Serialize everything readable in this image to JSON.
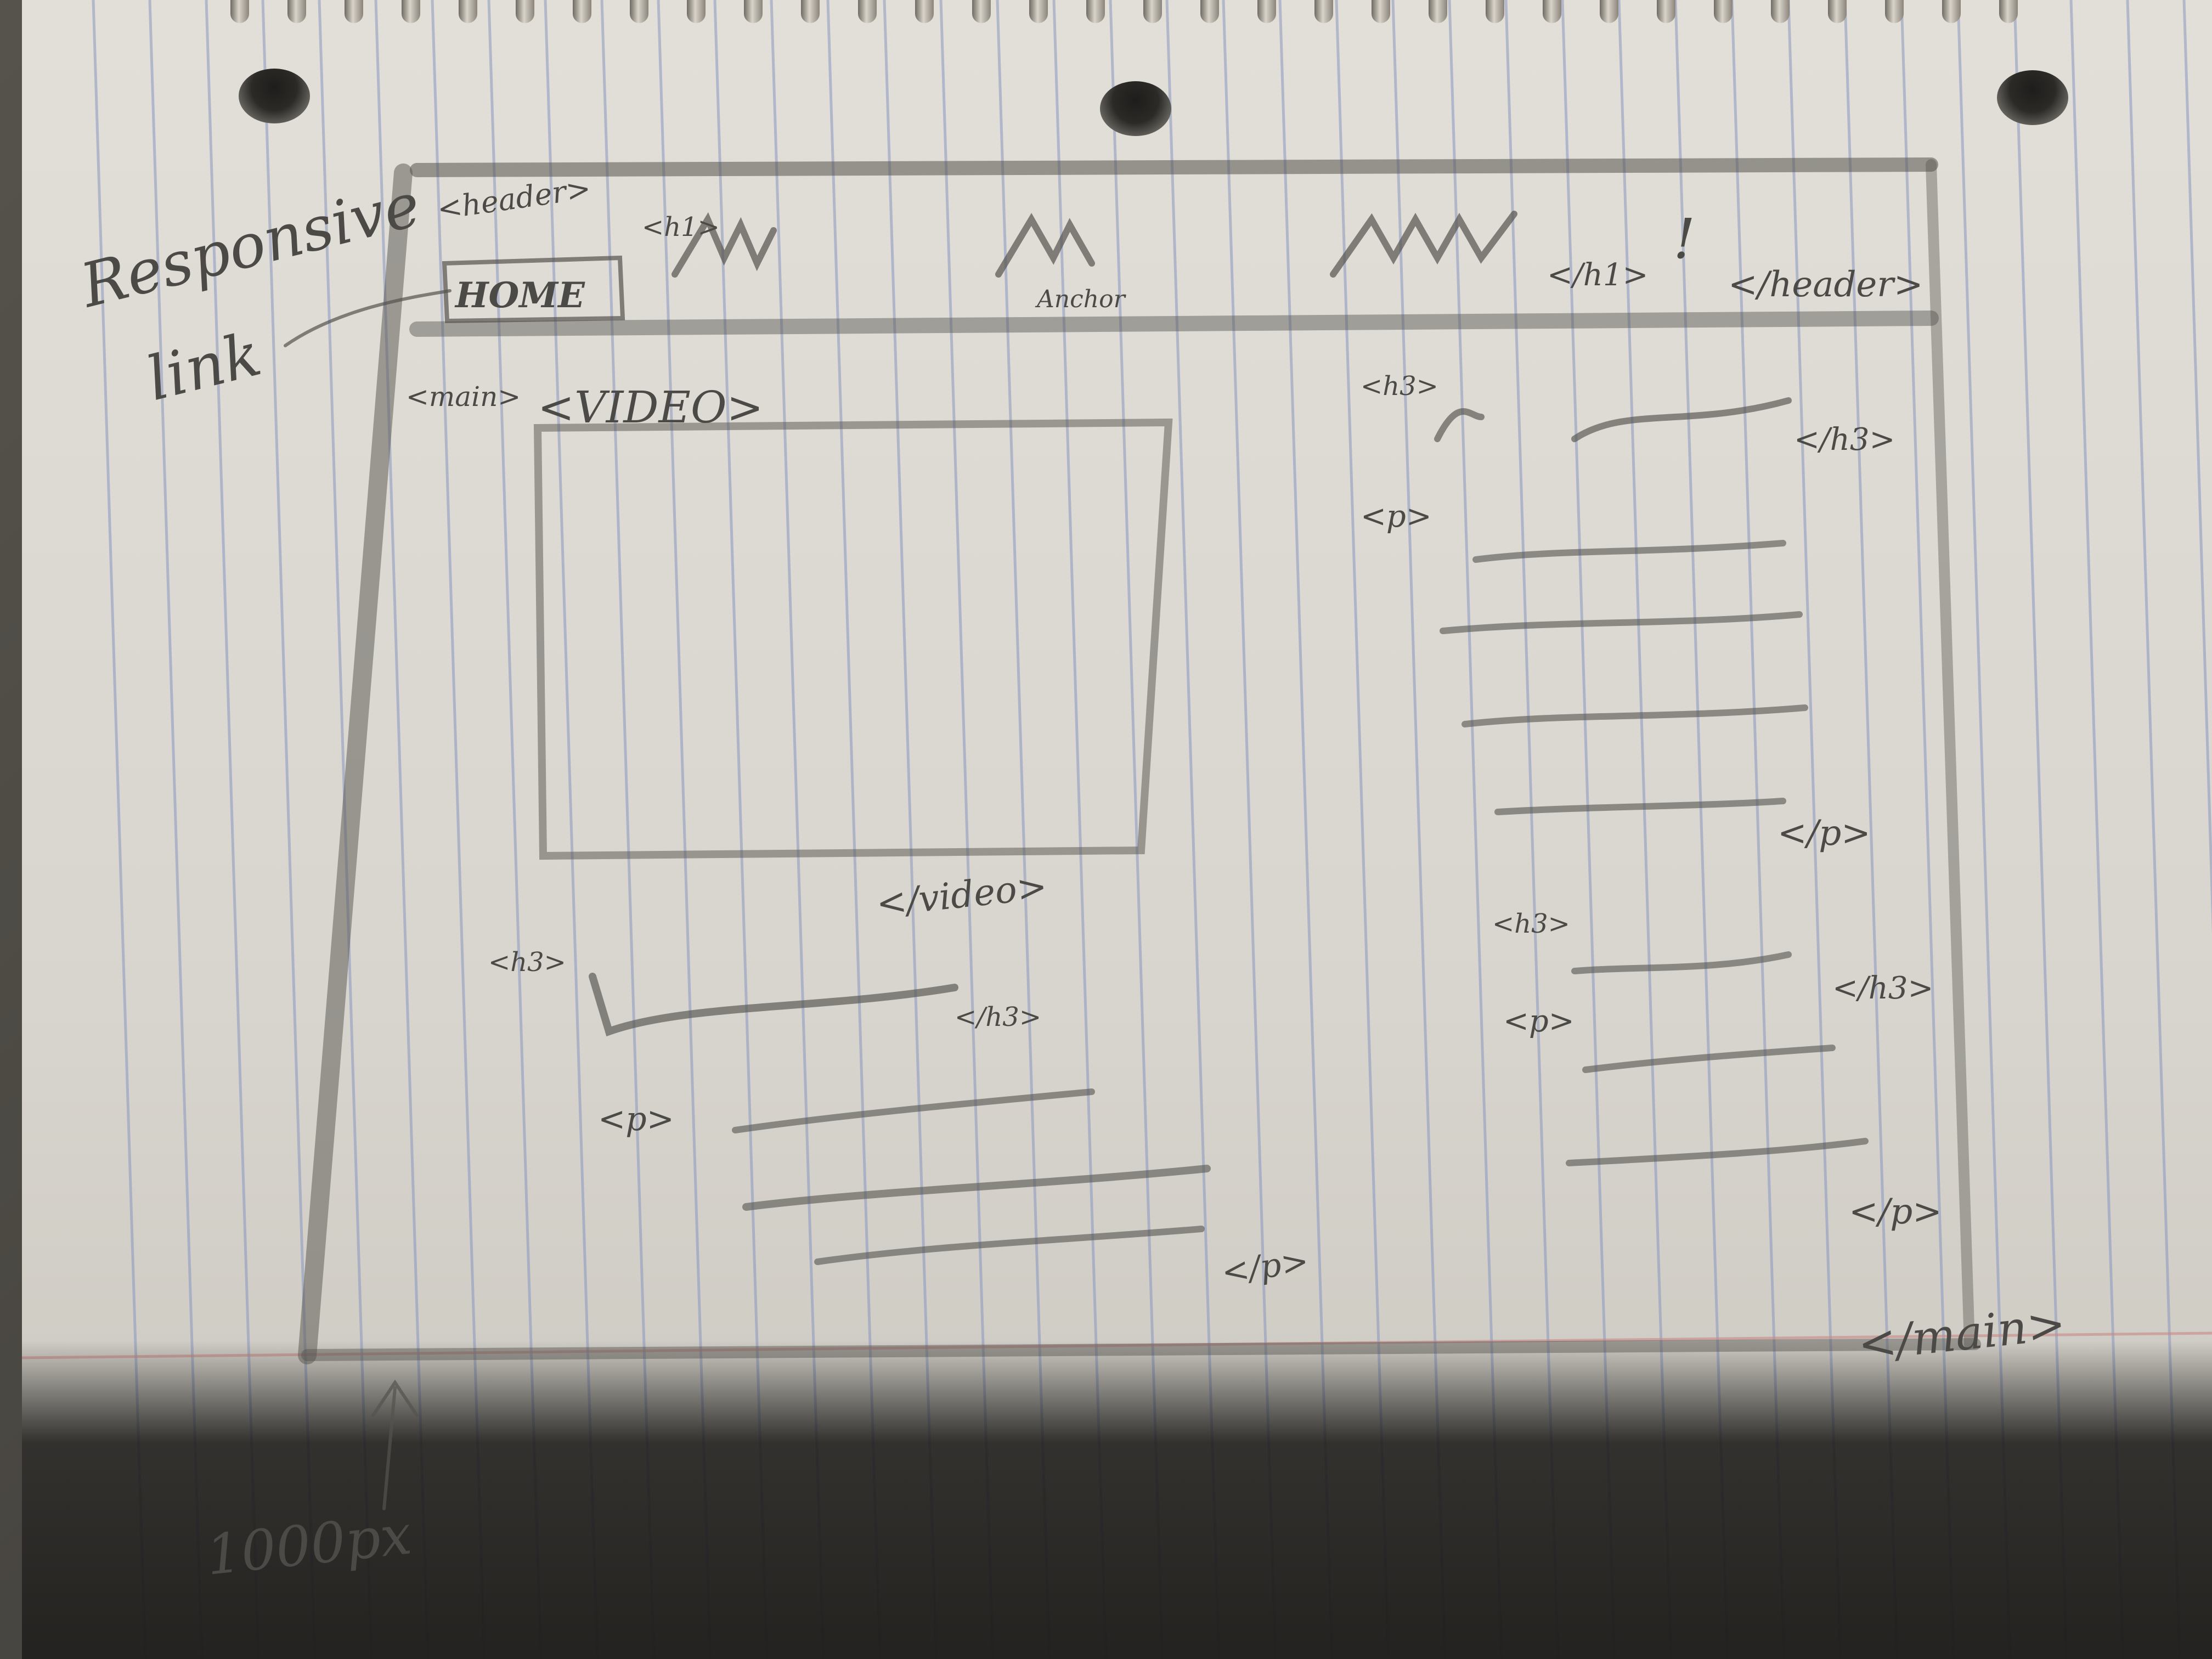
{
  "sketch": {
    "margin_notes": {
      "responsive_link": [
        "Responsive",
        "link"
      ],
      "width_note": "1000px"
    },
    "header_block": {
      "open_tag": "<header>",
      "nav_link": "HOME",
      "h1_open": "<h1>",
      "anchor_label": "Anchor",
      "h1_close": "</h1>",
      "exclamation": "!",
      "close_tag": "</header>"
    },
    "main_block": {
      "open_tag": "<main>",
      "close_tag": "</main>",
      "video_open": "<VIDEO>",
      "video_close": "</video>",
      "left_h3_open": "<h3>",
      "left_h3_close": "</h3>",
      "left_p_open": "<p>",
      "left_p_close": "</p>",
      "right_h3_open": "<h3>",
      "right_h3_close": "</h3>",
      "right_p_open": "<p>",
      "right_p_close": "</p>",
      "right2_h3_open": "<h3>",
      "right2_h3_close": "</h3>",
      "right2_p_open": "<p>",
      "right2_p_close": "</p>"
    }
  }
}
